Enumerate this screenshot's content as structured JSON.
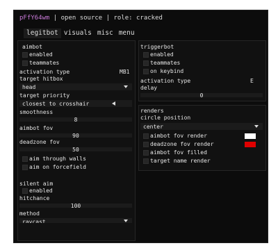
{
  "window": {
    "title_name": "pFfY64wm",
    "title_rest": " | open source | role: cracked"
  },
  "tabs": [
    {
      "label": "legitbot",
      "active": true
    },
    {
      "label": "visuals",
      "active": false
    },
    {
      "label": "misc",
      "active": false
    },
    {
      "label": "menu",
      "active": false
    }
  ],
  "aimbot": {
    "section": "aimbot",
    "enabled": "enabled",
    "teammates": "teammates",
    "activation_type_label": "activation type",
    "activation_type_value": "MB1",
    "target_hitbox_label": "target hitbox",
    "target_hitbox_value": "head",
    "target_priority_label": "target priority",
    "target_priority_value": "closest to crosshair",
    "smoothness_label": "smoothness",
    "smoothness_value": "8",
    "max_fov_label": "aimbot fov",
    "max_fov_value": "90",
    "deadzone_label": "deadzone fov",
    "deadzone_value": "50",
    "aim_through_walls": "aim through walls",
    "aim_on_forcefield": "aim on forcefield"
  },
  "silent_aim": {
    "section": "silent aim",
    "enabled": "enabled",
    "hitchance_label": "hitchance",
    "hitchance_value": "100",
    "method_label": "method",
    "method_value": "raycast"
  },
  "triggerbot": {
    "section": "triggerbot",
    "enabled": "enabled",
    "teammates": "teammates",
    "on_keybind": "on keybind",
    "activation_type_label": "activation type",
    "activation_type_value": "E",
    "delay_label": "delay",
    "delay_value": "0"
  },
  "renders": {
    "section": "renders",
    "circle_position_label": "circle position",
    "circle_position_value": "center",
    "aimbot_fov_render": "aimbot fov render",
    "aimbot_fov_color": "#ffffff",
    "deadzone_fov_render": "deadzone fov render",
    "deadzone_fov_color": "#e00000",
    "aimbot_fov_filled": "aimbot fov filled",
    "target_name_render": "target name render"
  }
}
